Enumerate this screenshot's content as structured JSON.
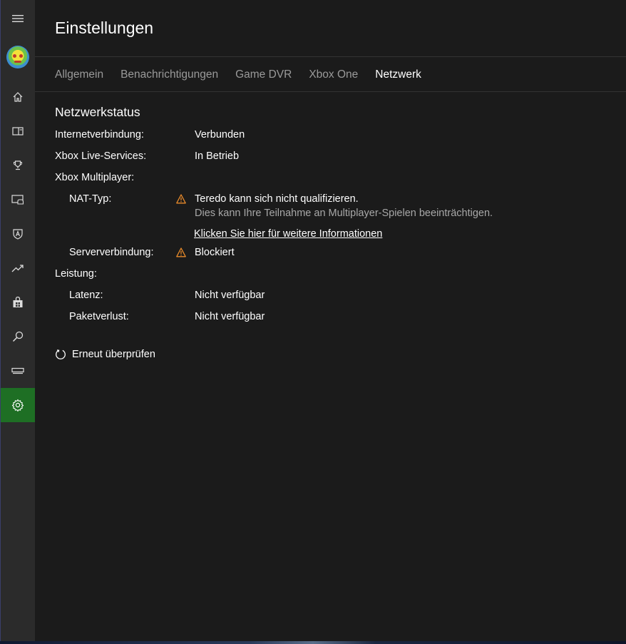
{
  "sidebar": {
    "items": [
      {
        "icon": "hamburger-menu-icon"
      },
      {
        "icon": "avatar"
      },
      {
        "icon": "home-icon"
      },
      {
        "icon": "collection-icon"
      },
      {
        "icon": "trophy-icon"
      },
      {
        "icon": "game-dvr-icon"
      },
      {
        "icon": "clubs-icon"
      },
      {
        "icon": "trending-icon"
      },
      {
        "icon": "store-icon"
      },
      {
        "icon": "search-icon"
      },
      {
        "icon": "connect-icon"
      },
      {
        "icon": "settings-gear-icon",
        "active": true
      }
    ],
    "accent": "#1e6f24"
  },
  "header": {
    "title": "Einstellungen"
  },
  "tabs": [
    {
      "label": "Allgemein"
    },
    {
      "label": "Benachrichtigungen"
    },
    {
      "label": "Game DVR"
    },
    {
      "label": "Xbox One"
    },
    {
      "label": "Netzwerk",
      "active": true
    }
  ],
  "network": {
    "section_title": "Netzwerkstatus",
    "internet_label": "Internetverbindung:",
    "internet_value": "Verbunden",
    "live_label": "Xbox Live-Services:",
    "live_value": "In Betrieb",
    "multiplayer_label": "Xbox Multiplayer:",
    "nat_label": "NAT-Typ:",
    "nat_value": "Teredo kann sich nicht qualifizieren.",
    "nat_sub": "Dies kann Ihre Teilnahme an Multiplayer-Spielen beeinträchtigen.",
    "nat_link": "Klicken Sie hier für weitere Informationen",
    "server_label": "Serververbindung:",
    "server_value": "Blockiert",
    "performance_label": "Leistung:",
    "latency_label": "Latenz:",
    "latency_value": "Nicht verfügbar",
    "packet_label": "Paketverlust:",
    "packet_value": "Nicht verfügbar",
    "warning_color": "#e88a2a"
  },
  "actions": {
    "retry_label": "Erneut überprüfen"
  }
}
